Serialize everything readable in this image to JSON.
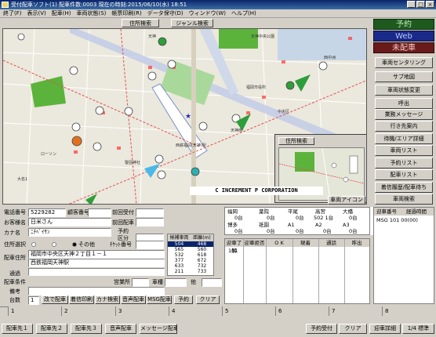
{
  "window": {
    "title": "受付配車ソフト(1) 配車件数:0003 現在の時刻:2015/06/10(水) 18:51",
    "min": "_",
    "max": "□",
    "close": "×"
  },
  "menu": [
    "終了(F)",
    "表示(V)",
    "配車(H)",
    "車両状態(S)",
    "帳票印刷(R)",
    "データ保守(D)",
    "ウィンドウ(W)",
    "ヘルプ(H)"
  ],
  "search": {
    "address": "住所検索",
    "genre": "ジャンル検索"
  },
  "status_buttons": {
    "yoyaku": "予約",
    "web": "Web",
    "mihaisha": "未配車"
  },
  "right_buttons": [
    "車両センタリング",
    "サブ地図",
    "車両状態変更",
    "呼出",
    "業務メッセージ",
    "行き先案内",
    "待機/エリア詳細",
    "車両リスト",
    "予約リスト",
    "配車リスト",
    "着信履歴/配車待ち",
    "車両検索"
  ],
  "map": {
    "copyright": "C INCREMENT P CORPORATION",
    "car_icon_button": "車両アイコン",
    "sub_address_button": "住所検索",
    "places": [
      "天神中央公園",
      "アクロス福岡",
      "天神北",
      "天神",
      "福岡市役所",
      "中央区",
      "西鉄福岡(天神)駅",
      "警固神社",
      "天神南",
      "渡辺通一丁目",
      "春吉",
      "大名1",
      "西中洲",
      "ローソン",
      "赤坂",
      "大名2",
      "渡辺通",
      "西中洲"
    ],
    "vehicles": [
      "201",
      "501",
      "667",
      "657",
      "632",
      "506",
      "615",
      "686",
      "620",
      "601",
      "633",
      "641",
      "617",
      "665",
      "690",
      "637",
      "645",
      "671",
      "688"
    ]
  },
  "phone": {
    "label": "電話番号",
    "value": "5229282",
    "cust_code_label": "顧客番号",
    "prev_recv": "前回受付"
  },
  "customer": {
    "label": "お客様名",
    "value": "日米さん",
    "prev_dispatch": "前回配車"
  },
  "kana": {
    "label": "カナ名",
    "value": "ﾆﾁﾍﾞｲｻﾝ",
    "reserve": "予約",
    "kubun": "区分"
  },
  "addr_select": {
    "label": "住所選択",
    "opt_other": "その他",
    "ticket": "ﾁｹｯﾄ番号"
  },
  "dispatch_addr": {
    "label": "配車住所",
    "line1": "福岡市中央区天神２丁目１－１",
    "line2": "西鉄福岡天神駅"
  },
  "route_label": "通過",
  "cond": {
    "label": "配車条件",
    "office": "営業所",
    "car": "車種",
    "other": "他"
  },
  "remarks_label": "備考",
  "count": {
    "label": "台数",
    "value": "1"
  },
  "form_buttons": [
    "改で配車",
    "着信印刷",
    "カナ検索",
    "音声配車",
    "MSG配車",
    "予約",
    "クリア"
  ],
  "nearby": {
    "title_car": "候補車両",
    "title_dist": "距離(m)",
    "rows": [
      [
        "504",
        "468"
      ],
      [
        "565",
        "560"
      ],
      [
        "532",
        "618"
      ],
      [
        "377",
        "672"
      ],
      [
        "633",
        "732"
      ],
      [
        "211",
        "733"
      ]
    ]
  },
  "areas": [
    {
      "name": "福岡",
      "cells": [
        "0台",
        "薬院",
        "0台",
        "平尾",
        "0台",
        "高宮",
        "502  1台",
        "大橋",
        "0台"
      ]
    },
    {
      "name": "博多",
      "cells": [
        "0台",
        "祇園",
        "0台",
        "A1",
        "0台",
        "A2",
        "0台",
        "A3",
        "0台"
      ]
    }
  ],
  "area_extra": "0台",
  "dispatch_table": {
    "headers": [
      "迎車了解",
      "迎車拒否",
      "O K",
      "現着",
      "通話",
      "呼出"
    ],
    "first": "101"
  },
  "message_table": {
    "headers": [
      "迎車番号",
      "経過時間"
    ],
    "row": "MSG  101  00(00)"
  },
  "tabs": [
    "1",
    "2",
    "3",
    "4",
    "5",
    "6",
    "7",
    "8"
  ],
  "bottom_left": [
    "配車先１",
    "配車先２",
    "配車先３",
    "音声配車",
    "メッセージ配車"
  ],
  "bottom_right": [
    "予約受付",
    "クリア",
    "迎車詳細",
    "1/4 標準"
  ]
}
